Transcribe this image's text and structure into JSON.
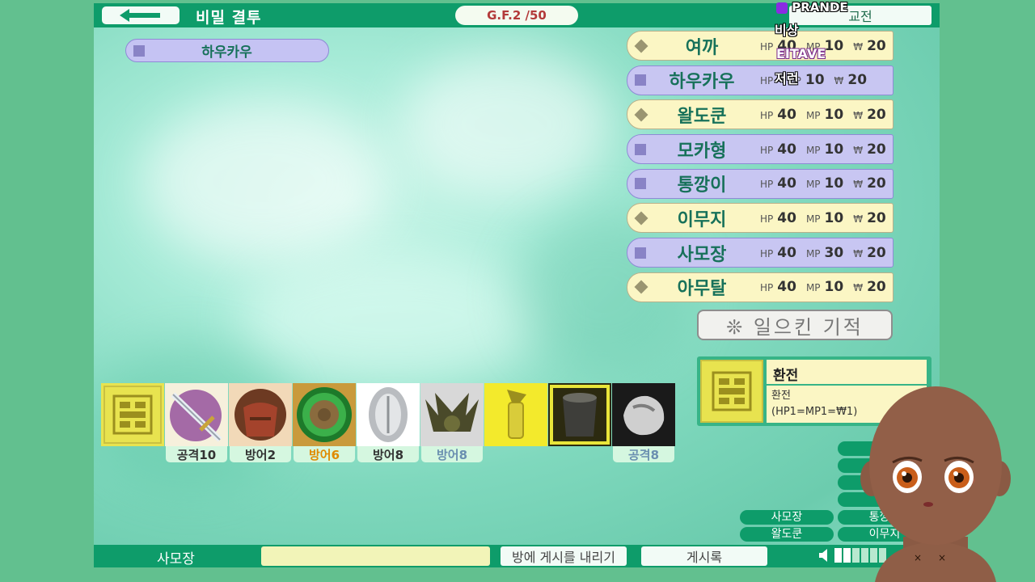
{
  "header": {
    "title": "비밀 결투",
    "gf": "G.F.2 /50",
    "exchange": "교전"
  },
  "self_tag": {
    "name": "하우카우"
  },
  "players": [
    {
      "name": "여까",
      "marker": "diamond",
      "hp_label": "HP",
      "hp": "40",
      "mp_label": "MP",
      "mp": "10",
      "money_label": "₩",
      "money": "20"
    },
    {
      "name": "하우카우",
      "marker": "square",
      "hp_label": "HP",
      "hp": "",
      "mp_label": "MP",
      "mp": "10",
      "money_label": "₩",
      "money": "20"
    },
    {
      "name": "왈도쿤",
      "marker": "diamond",
      "hp_label": "HP",
      "hp": "40",
      "mp_label": "MP",
      "mp": "10",
      "money_label": "₩",
      "money": "20"
    },
    {
      "name": "모카형",
      "marker": "square",
      "hp_label": "HP",
      "hp": "40",
      "mp_label": "MP",
      "mp": "10",
      "money_label": "₩",
      "money": "20"
    },
    {
      "name": "통깡이",
      "marker": "square",
      "hp_label": "HP",
      "hp": "40",
      "mp_label": "MP",
      "mp": "10",
      "money_label": "₩",
      "money": "20"
    },
    {
      "name": "이무지",
      "marker": "diamond",
      "hp_label": "HP",
      "hp": "40",
      "mp_label": "MP",
      "mp": "10",
      "money_label": "₩",
      "money": "20"
    },
    {
      "name": "사모장",
      "marker": "square",
      "hp_label": "HP",
      "hp": "40",
      "mp_label": "MP",
      "mp": "30",
      "money_label": "₩",
      "money": "20"
    },
    {
      "name": "아무탈",
      "marker": "diamond",
      "hp_label": "HP",
      "hp": "40",
      "mp_label": "MP",
      "mp": "10",
      "money_label": "₩",
      "money": "20"
    }
  ],
  "miracle_button": "❊ 일으킨 기적",
  "selected_card": {
    "title": "환전",
    "line1": "환전",
    "line2": "(HP1=MP1=₩1)"
  },
  "items": [
    {
      "icon": "exchange-rune-icon",
      "label": ""
    },
    {
      "icon": "sword-icon",
      "label": "공격10",
      "label_color": "#333333"
    },
    {
      "icon": "leather-armor-icon",
      "label": "방어2",
      "label_color": "#333333"
    },
    {
      "icon": "green-shield-icon",
      "label": "방어6",
      "label_color": "#e08a00"
    },
    {
      "icon": "silver-shield-icon",
      "label": "방어8",
      "label_color": "#333333"
    },
    {
      "icon": "horned-helmet-icon",
      "label": "방어8",
      "label_color": "#6a8fb0"
    },
    {
      "icon": "potion-vial-icon",
      "label": ""
    },
    {
      "icon": "dark-cauldron-icon",
      "label": ""
    },
    {
      "icon": "rock-fist-icon",
      "label": "공격8",
      "label_color": "#6a8fb0"
    }
  ],
  "target_pills": {
    "left": [
      "사모장",
      "왈도쿤"
    ],
    "right": [
      "통깡이",
      "이무지"
    ]
  },
  "bottom": {
    "name": "사모장",
    "input_value": "",
    "post_button": "방에 게시를 내리기",
    "board_button": "게시록"
  },
  "overlay": {
    "badge": "PRANDE",
    "l1": "비상",
    "l2": "EITAVE",
    "l3": "저런"
  },
  "colors": {
    "accent": "#0e9c6a",
    "background": "#62c08f",
    "name_text": "#17715a"
  }
}
